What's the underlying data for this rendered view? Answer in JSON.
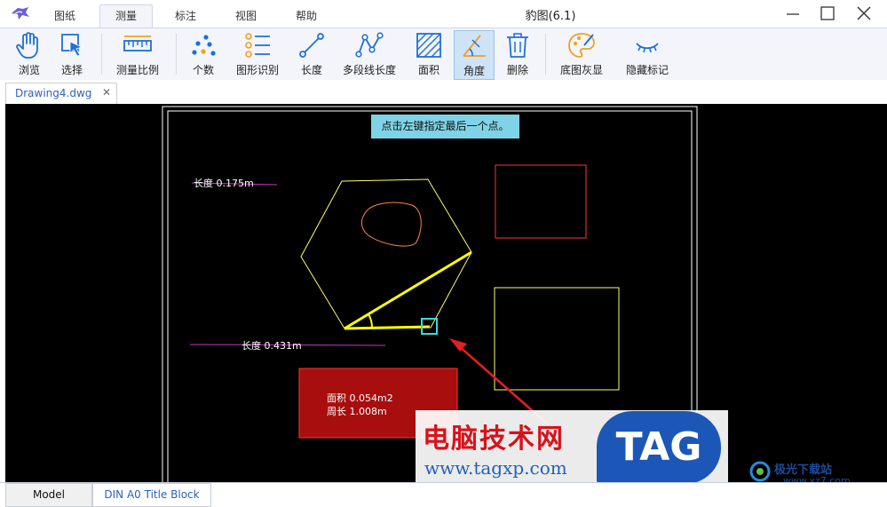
{
  "app": {
    "title": "豹图(6.1)"
  },
  "menu": {
    "tabs": [
      {
        "label": "图纸"
      },
      {
        "label": "测量",
        "active": true
      },
      {
        "label": "标注"
      },
      {
        "label": "视图"
      },
      {
        "label": "帮助"
      }
    ]
  },
  "toolbar": {
    "items": [
      {
        "label": "浏览",
        "icon": "hand-icon"
      },
      {
        "label": "选择",
        "icon": "cursor-select-icon"
      },
      {
        "label": "测量比例",
        "icon": "ruler-icon"
      },
      {
        "label": "个数",
        "icon": "dots-count-icon"
      },
      {
        "label": "图形识别",
        "icon": "list-recognize-icon"
      },
      {
        "label": "长度",
        "icon": "line-length-icon"
      },
      {
        "label": "多段线长度",
        "icon": "polyline-icon"
      },
      {
        "label": "面积",
        "icon": "area-hatch-icon"
      },
      {
        "label": "角度",
        "icon": "angle-icon",
        "active": true
      },
      {
        "label": "删除",
        "icon": "trash-icon"
      },
      {
        "label": "底图灰显",
        "icon": "palette-icon"
      },
      {
        "label": "隐藏标记",
        "icon": "eye-closed-icon"
      }
    ]
  },
  "document": {
    "tab_name": "Drawing4.dwg",
    "close_glyph": "✕"
  },
  "canvas": {
    "hint": "点击左键指定最后一个点。",
    "measure_length_1": "长度 0.175m",
    "measure_length_2": "长度 0.431m",
    "measure_area": "面积 0.054m2",
    "measure_perimeter": "周长 1.008m"
  },
  "watermark": {
    "site_name": "电脑技术网",
    "site_url": "www.tagxp.com",
    "logo_text": "TAG",
    "brand2": "极光下载站",
    "brand2_url": "www.xz7.com"
  },
  "layout_tabs": [
    {
      "label": "Model",
      "active": true
    },
    {
      "label": "DIN A0 Title Block"
    }
  ],
  "colors": {
    "accent": "#1e6fd9",
    "canvas_bg": "#000000",
    "hexagon": "#ffff66",
    "angle_measure": "#ffff00",
    "rect_red": "#ff3333",
    "area_fill": "#a80e0e",
    "hint_bg": "#7fd3e6",
    "marker": "#33dddd",
    "arrow": "#e02020",
    "magenta_line": "#cc33cc"
  }
}
